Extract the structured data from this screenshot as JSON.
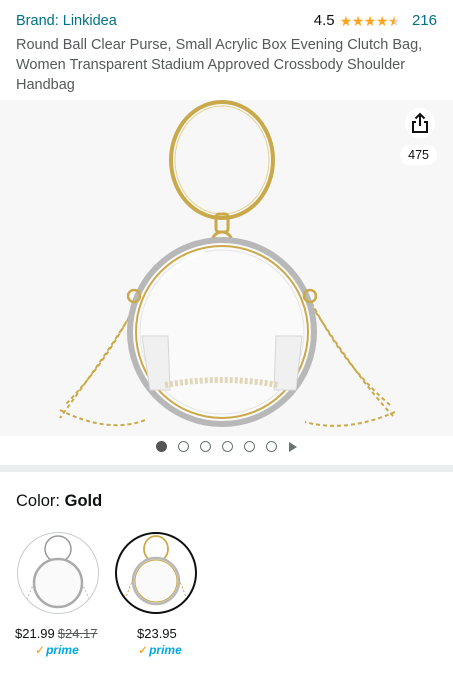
{
  "product": {
    "brand": "Brand: Linkidea",
    "rating": "4.5",
    "rating_count": "216",
    "title": "Round Ball Clear Purse, Small Acrylic Box Evening Clutch Bag, Women Transparent Stadium Approved Crossbody Shoulder Handbag",
    "stars": 4.5
  },
  "gallery": {
    "share_count": "475",
    "total_images": 6,
    "active_index": 0,
    "share_icon": "share-icon"
  },
  "variant": {
    "label": "Color: ",
    "selected": "Gold"
  },
  "options": [
    {
      "price": "$21.99",
      "list_price": "$24.17",
      "prime": "prime"
    },
    {
      "price": "$23.95",
      "list_price": "",
      "prime": "prime"
    }
  ],
  "colors": {
    "link": "#007185",
    "star": "#ffa41c",
    "prime": "#00a8e1",
    "gold": "#c9a94a"
  }
}
